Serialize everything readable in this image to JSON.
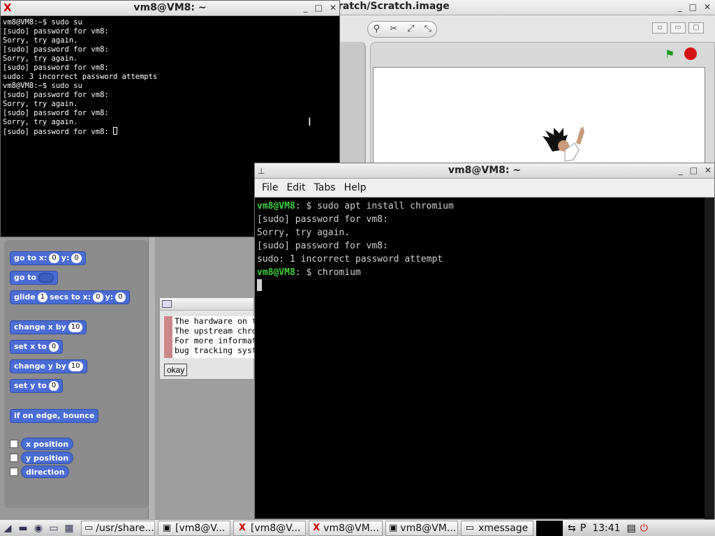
{
  "scratch": {
    "title": "ratch/Scratch.image",
    "blocks": [
      {
        "label": "go to x:",
        "slot1": "0",
        "mid": "y:",
        "slot2": "0"
      },
      {
        "label": "go to"
      },
      {
        "label": "glide",
        "slot1": "1",
        "mid": "secs to x:",
        "slot2": "0",
        "mid2": "y:",
        "slot3": "0"
      },
      {
        "label": "change x by",
        "slot1": "10"
      },
      {
        "label": "set x to",
        "slot1": "0"
      },
      {
        "label": "change y by",
        "slot1": "10"
      },
      {
        "label": "set y to",
        "slot1": "0"
      },
      {
        "label": "if on edge, bounce"
      }
    ],
    "reporters": [
      "x position",
      "y position",
      "direction"
    ]
  },
  "xmessage": {
    "text": "The hardware on t\nThe upstream chro\nFor more informat\nbug tracking syst",
    "okay": "okay"
  },
  "xterm": {
    "title": "vm8@VM8: ~",
    "lines": [
      "vm8@VM8:~$ sudo su",
      "[sudo] password for vm8:",
      "Sorry, try again.",
      "[sudo] password for vm8:",
      "Sorry, try again.",
      "[sudo] password for vm8:",
      "sudo: 3 incorrect password attempts",
      "vm8@VM8:~$ sudo su",
      "[sudo] password for vm8:",
      "Sorry, try again.",
      "[sudo] password for vm8:",
      "Sorry, try again.",
      "[sudo] password for vm8: "
    ]
  },
  "terminal": {
    "title": "vm8@VM8: ~",
    "menu": [
      "File",
      "Edit",
      "Tabs",
      "Help"
    ],
    "prompt_user": "vm8@VM8",
    "prompt_sep": ": $ ",
    "cmd1": "sudo apt install chromium",
    "out1": "[sudo] password for vm8:",
    "out2": "Sorry, try again.",
    "out3": "[sudo] password for vm8:",
    "out4": "sudo: 1 incorrect password attempt",
    "cmd2": "chromium"
  },
  "taskbar": {
    "tasks": [
      "/usr/share...",
      "[vm8@V...",
      "[vm8@V...",
      "vm8@VM...",
      "vm8@VM...",
      "xmessage"
    ],
    "clock": "13:41"
  }
}
